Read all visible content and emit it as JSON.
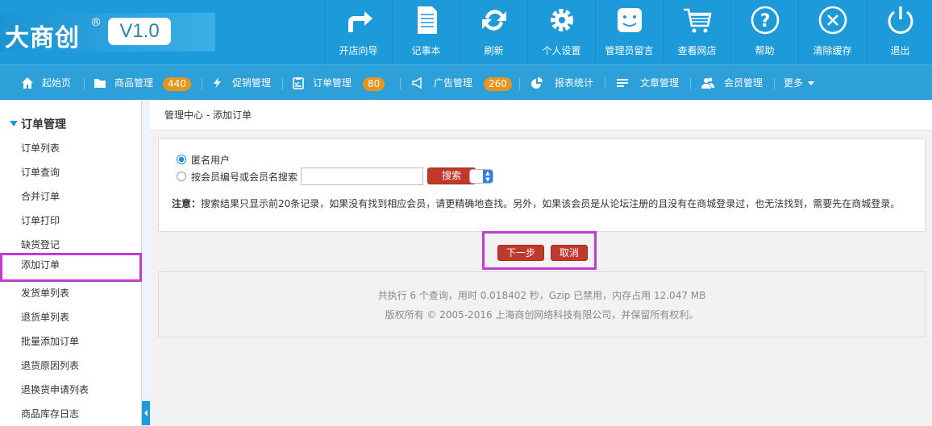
{
  "logo": {
    "text": "大商创",
    "registered": "®",
    "version": "V1.0"
  },
  "toolbar": [
    {
      "label": "开店向导",
      "icon": "share-arrow-icon"
    },
    {
      "label": "记事本",
      "icon": "notepad-icon"
    },
    {
      "label": "刷新",
      "icon": "refresh-icon"
    },
    {
      "label": "个人设置",
      "icon": "gear-icon"
    },
    {
      "label": "管理员留言",
      "icon": "message-face-icon"
    },
    {
      "label": "查看网店",
      "icon": "cart-icon"
    },
    {
      "label": "帮助",
      "icon": "help-icon"
    },
    {
      "label": "清除缓存",
      "icon": "clear-icon"
    },
    {
      "label": "退出",
      "icon": "power-icon"
    }
  ],
  "nav": {
    "home": "起始页",
    "goods": "商品管理",
    "goods_count": "440",
    "promo": "促销管理",
    "orders": "订单管理",
    "orders_count": "80",
    "ads": "广告管理",
    "ads_count": "260",
    "reports": "报表统计",
    "articles": "文章管理",
    "members": "会员管理",
    "more": "更多"
  },
  "sidebar": {
    "title": "订单管理",
    "items": [
      "订单列表",
      "订单查询",
      "合并订单",
      "订单打印",
      "缺货登记",
      "添加订单",
      "发货单列表",
      "退货单列表",
      "批量添加订单",
      "退货原因列表",
      "退换货申请列表",
      "商品库存日志"
    ],
    "selected": "添加订单"
  },
  "breadcrumb": {
    "root": "管理中心",
    "separator": " - ",
    "current": "添加订单"
  },
  "form": {
    "anonymous_label": "匿名用户",
    "member_search_label": "按会员编号或会员名搜索",
    "search_value": "",
    "search_button": "搜索",
    "note_label": "注意：",
    "note_text": "搜索结果只显示前20条记录，如果没有找到相应会员，请更精确地查找。另外，如果该会员是从论坛注册的且没有在商城登录过，也无法找到，需要先在商城登录。"
  },
  "actions": {
    "next": "下一步",
    "cancel": "取消"
  },
  "footer": {
    "line1": "共执行 6 个查询，用时 0.018402 秒，Gzip 已禁用，内存占用 12.047 MB",
    "line2": "版权所有 © 2005-2016 上海商创网络科技有限公司，并保留所有权利。"
  },
  "colors": {
    "header": "#1c9ad9",
    "nav": "#2d9fd9",
    "badge": "#e8951d",
    "button": "#c0392b",
    "highlight": "#c33bd3"
  }
}
